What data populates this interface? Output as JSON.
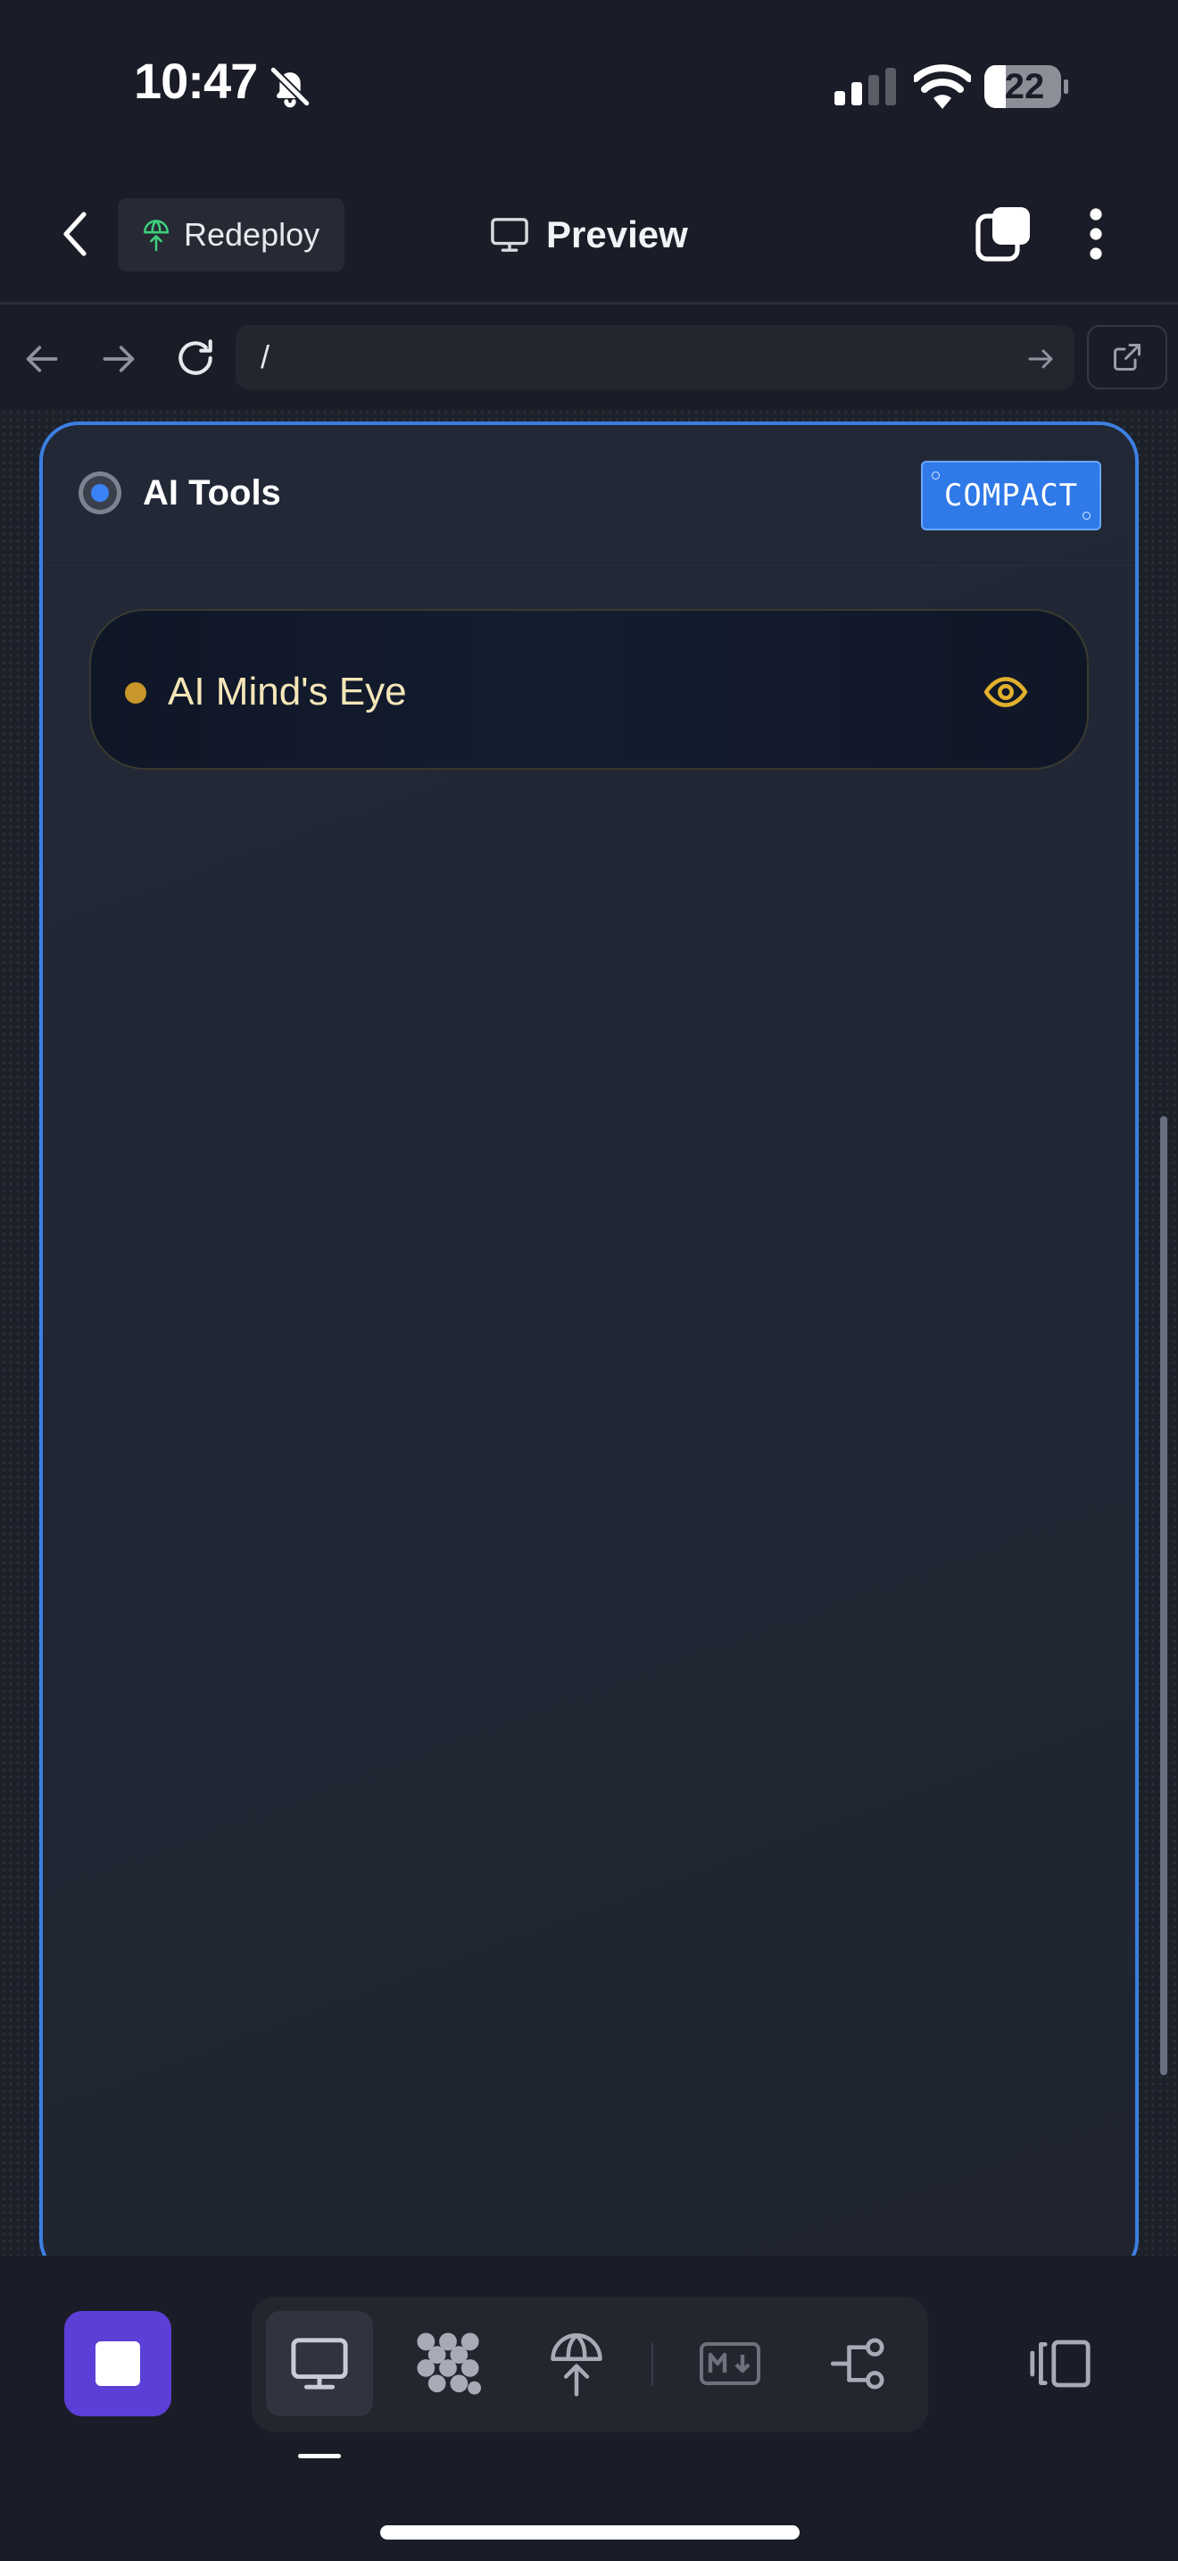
{
  "status_bar": {
    "time": "10:47",
    "battery": "22",
    "icons": [
      "bell-slash-icon",
      "cellular-signal-icon",
      "wifi-icon",
      "battery-icon"
    ]
  },
  "header": {
    "back_icon": "chevron-left-icon",
    "redeploy_label": "Redeploy",
    "redeploy_icon": "globe-upload-icon",
    "title": "Preview",
    "title_icon": "monitor-icon",
    "tabs_icon": "tabs-icon",
    "more_icon": "more-vertical-icon"
  },
  "url_bar": {
    "url": "/",
    "nav_icons": [
      "arrow-left-icon",
      "arrow-right-icon",
      "reload-icon",
      "go-arrow-icon",
      "external-link-icon"
    ]
  },
  "app": {
    "title": "AI Tools",
    "compact_label": "COMPACT",
    "tools": [
      {
        "label": "AI Mind's Eye",
        "status_color": "#c8962a",
        "icon": "eye-icon"
      }
    ]
  },
  "bottom_bar": {
    "buttons": [
      "stop-icon",
      "monitor-icon",
      "apps-icon",
      "deploy-icon",
      "markdown-icon",
      "flow-icon",
      "panel-icon"
    ],
    "active": "monitor-icon"
  },
  "colors": {
    "accent": "#3c7fe0",
    "stop_button": "#5b3fd6",
    "tool_gold": "#e2b02c"
  }
}
